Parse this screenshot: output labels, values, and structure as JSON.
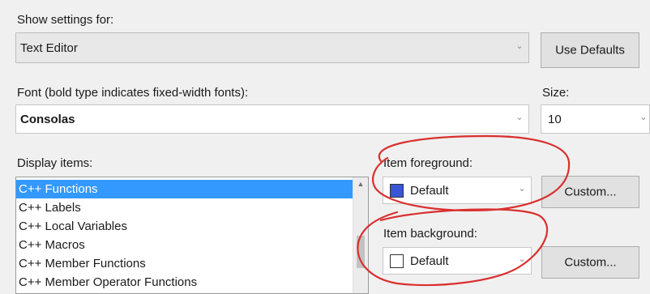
{
  "show_settings": {
    "label": "Show settings for:",
    "value": "Text Editor",
    "use_defaults_label": "Use Defaults"
  },
  "font": {
    "label": "Font (bold type indicates fixed-width fonts):",
    "value": "Consolas",
    "size_label": "Size:",
    "size_value": "10"
  },
  "display_items": {
    "label": "Display items:",
    "items": [
      "C++ Functions",
      "C++ Labels",
      "C++ Local Variables",
      "C++ Macros",
      "C++ Member Functions",
      "C++ Member Operator Functions"
    ],
    "selected_index": 0
  },
  "item_foreground": {
    "label": "Item foreground:",
    "value": "Default",
    "swatch_color": "#3a56d4",
    "custom_label": "Custom..."
  },
  "item_background": {
    "label": "Item background:",
    "value": "Default",
    "swatch_color": "#ffffff",
    "custom_label": "Custom..."
  },
  "annotation_color": "#d9302f"
}
